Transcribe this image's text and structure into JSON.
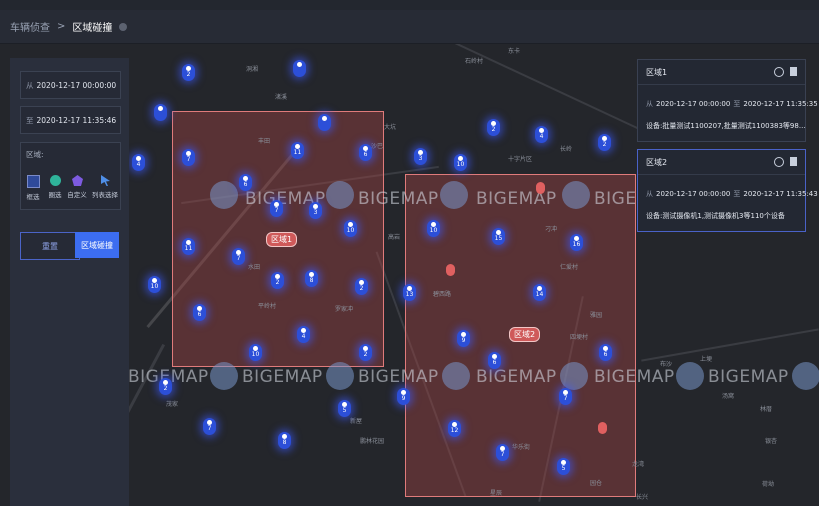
{
  "header": {
    "parent_crumb": "车辆侦查",
    "separator": ">",
    "current_crumb": "区域碰撞"
  },
  "sidebar": {
    "from_prefix": "从",
    "from_value": "2020-12-17 00:00:00",
    "to_prefix": "至",
    "to_value": "2020-12-17 11:35:46",
    "area_label": "区域:",
    "tools": [
      {
        "label": "框选",
        "icon": "rectangle-select-icon"
      },
      {
        "label": "圈选",
        "icon": "circle-select-icon"
      },
      {
        "label": "自定义",
        "icon": "polygon-select-icon"
      },
      {
        "label": "列表选择",
        "icon": "cursor-list-icon"
      }
    ],
    "reset_label": "重置",
    "collide_label": "区域碰撞"
  },
  "map": {
    "watermark": "BIGEMAP",
    "region1_label": "区域1",
    "region2_label": "区域2",
    "clusters": [
      "2",
      "4",
      "2",
      "2",
      "7",
      "11",
      "6",
      "7",
      "3",
      "10",
      "6",
      "4",
      "3",
      "10",
      "11",
      "7",
      "2",
      "8",
      "10",
      "6",
      "4",
      "10",
      "2",
      "2",
      "10",
      "6",
      "7",
      "15",
      "16",
      "13",
      "14",
      "9",
      "6",
      "2",
      "5",
      "9",
      "12",
      "7",
      "8",
      "7",
      "5",
      "6",
      "8",
      "7",
      "4"
    ],
    "labels": [
      "洞湘",
      "东卡",
      "石岭村",
      "渚溪",
      "大坑",
      "沙巴",
      "丰田",
      "罗家冲",
      "高岩",
      "十字片区",
      "平岭村",
      "长岭",
      "仁爱村",
      "刁冲",
      "碧西路",
      "水田",
      "雅园",
      "四埂村",
      "上埂",
      "茂家",
      "新屋",
      "鹏林花园",
      "华乐街",
      "龙湾",
      "布沙",
      "林厝",
      "汤窝",
      "银杏",
      "荷坳",
      "星辰",
      "园仓",
      "长兴"
    ]
  },
  "cards": [
    {
      "title": "区域1",
      "from_prefix": "从",
      "from_value": "2020-12-17 00:00:00",
      "to_prefix": "至",
      "to_value": "2020-12-17 11:35:35",
      "device_prefix": "设备:",
      "device_value": "批量测试1100207,批量测试1100383等98..."
    },
    {
      "title": "区域2",
      "from_prefix": "从",
      "from_value": "2020-12-17 00:00:00",
      "to_prefix": "至",
      "to_value": "2020-12-17 11:35:43",
      "device_prefix": "设备:",
      "device_value": "测试摄像机1,测试摄像机3等110个设备"
    }
  ]
}
